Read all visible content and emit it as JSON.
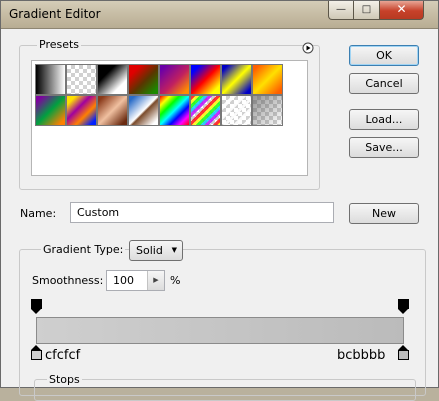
{
  "window": {
    "title": "Gradient Editor",
    "minimize_glyph": "—",
    "maximize_glyph": "□",
    "close_glyph": "✕"
  },
  "presets": {
    "label": "Presets",
    "menu_icon": "play-circle-icon",
    "swatches": [
      {
        "name": "foreground-to-background",
        "bg": "linear-gradient(to right, #000, #fff)"
      },
      {
        "name": "foreground-to-transparent",
        "bg": "checker-fade"
      },
      {
        "name": "black-white",
        "bg": "linear-gradient(135deg, #000 30%, #fff 75%)"
      },
      {
        "name": "red-green",
        "bg": "linear-gradient(135deg, #e00000 20%, #5a3500 55%, #1a8a00 90%)"
      },
      {
        "name": "violet-orange",
        "bg": "linear-gradient(135deg, #6a00a8 10%, #c02060 55%, #ff8c00 90%)"
      },
      {
        "name": "blue-red-yellow",
        "bg": "linear-gradient(135deg, #0000ff 15%, #ff0000 50%, #ffff00 85%)"
      },
      {
        "name": "blue-yellow-blue",
        "bg": "linear-gradient(135deg, #0000c8 10%, #ffff00 50%, #0000c8 90%)"
      },
      {
        "name": "orange-yellow-orange",
        "bg": "linear-gradient(135deg, #ff6000 10%, #ffe000 50%, #ff6000 90%)"
      },
      {
        "name": "violet-green-orange",
        "bg": "linear-gradient(135deg, #8000a0 10%, #00a040 50%, #ff8000 90%)"
      },
      {
        "name": "yellow-violet-orange-blue",
        "bg": "linear-gradient(135deg, #ffe000 15%, #a000a0 40%, #ff8000 65%, #0020ff 90%)"
      },
      {
        "name": "copper",
        "bg": "linear-gradient(135deg, #8a3a1a 10%, #f0c0a0 50%, #6a2a10 90%)"
      },
      {
        "name": "chrome",
        "bg": "linear-gradient(135deg, #2a6cc8 10%, #ffffff 50%, #7a4a2a 55%, #ffffff 90%)"
      },
      {
        "name": "spectrum",
        "bg": "linear-gradient(135deg, #ff0000, #ffff00, #00ff00, #00ffff, #0000ff, #ff00ff, #ff0000)"
      },
      {
        "name": "transparent-rainbow",
        "bg": "rainbow-checker"
      },
      {
        "name": "transparent-stripes",
        "bg": "stripe-checker"
      },
      {
        "name": "neutral-density",
        "bg": "checker-gray"
      }
    ]
  },
  "buttons": {
    "ok": "OK",
    "cancel": "Cancel",
    "load": "Load...",
    "save": "Save...",
    "new": "New"
  },
  "name_field": {
    "label": "Name:",
    "value": "Custom"
  },
  "gradient_type": {
    "label": "Gradient Type:",
    "value": "Solid"
  },
  "smoothness": {
    "label": "Smoothness:",
    "value": "100",
    "unit": "%"
  },
  "gradient": {
    "left_color_label": "cfcfcf",
    "right_color_label": "bcbbbb",
    "start_color": "#cfcfcf",
    "end_color": "#bbbbbb"
  },
  "stops_group": {
    "label": "Stops"
  }
}
